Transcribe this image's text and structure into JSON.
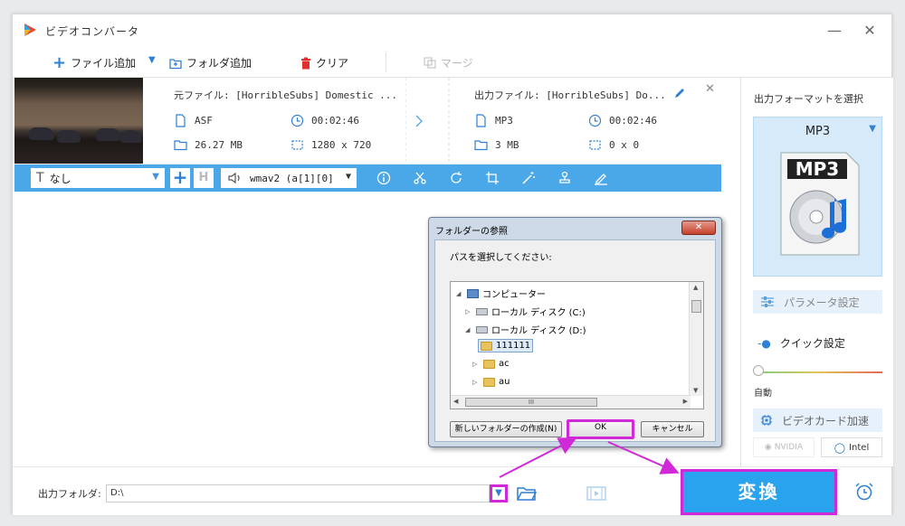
{
  "window": {
    "title": "ビデオコンバータ",
    "minimize": "—",
    "close": "✕"
  },
  "toolbar": {
    "add_file": "ファイル追加",
    "add_folder": "フォルダ追加",
    "clear": "クリア",
    "merge": "マージ"
  },
  "file_item": {
    "source_label": "元ファイル: [HorribleSubs] Domestic ...",
    "output_label": "出力ファイル: [HorribleSubs] Do...",
    "source": {
      "format": "ASF",
      "duration": "00:02:46",
      "size": "26.27 MB",
      "resolution": "1280 x 720"
    },
    "output": {
      "format": "MP3",
      "duration": "00:02:46",
      "size": "3 MB",
      "resolution": "0 x 0"
    }
  },
  "editbar": {
    "subtitle": "なし",
    "audio_track": "wmav2 (a[1][0]"
  },
  "right_panel": {
    "title": "出力フォーマットを選択",
    "format": "MP3",
    "param_settings": "パラメータ設定",
    "quick_settings": "クイック設定",
    "auto_label": "自動",
    "gpu_accel": "ビデオカード加速",
    "nvidia": "NVIDIA",
    "intel": "Intel"
  },
  "bottom": {
    "output_folder_label": "出力フォルダ:",
    "output_folder_value": "D:\\",
    "convert": "変換"
  },
  "dialog": {
    "title": "フォルダーの参照",
    "prompt": "パスを選択してください:",
    "tree": [
      {
        "label": "コンピューター",
        "expanded": true
      },
      {
        "label": "ローカル ディスク (C:)",
        "expanded": false
      },
      {
        "label": "ローカル ディスク (D:)",
        "expanded": true
      },
      {
        "label": "111111",
        "selected": true
      },
      {
        "label": "ac",
        "expanded": false
      },
      {
        "label": "au",
        "expanded": false
      }
    ],
    "hscroll_mark": "III",
    "new_folder": "新しいフォルダーの作成(N)",
    "ok": "OK",
    "cancel": "キャンセル"
  },
  "colors": {
    "accent": "#2aa3ee",
    "edit_bar": "#4aa8e8",
    "highlight": "#d02ad8"
  }
}
